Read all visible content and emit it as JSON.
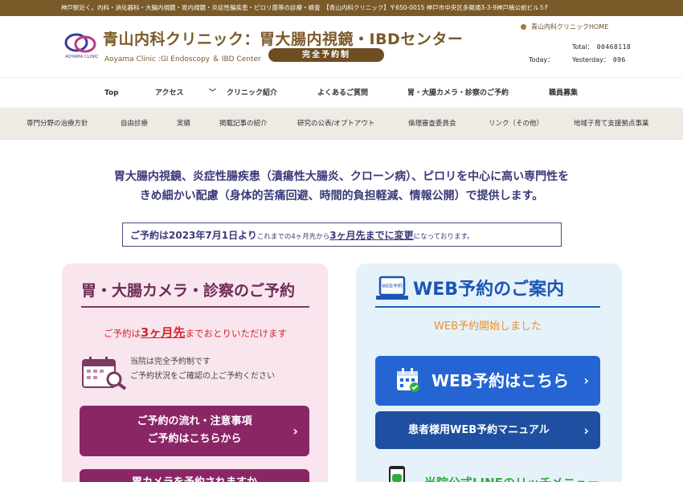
{
  "topbar": {
    "text": "神戸駅近く。内科・消化器科・大腸内視鏡・胃内視鏡・炎症性腸疾患・ピロリ菌等の診療・検査　【青山内科クリニック】〒650-0015 神戸市中央区多聞通3-3-9神戸楠公前ビル５F"
  },
  "header": {
    "logo_caption": "AOYAMA CLINIC",
    "title": "青山内科クリニック：胃大腸内視鏡・IBDセンター",
    "subtitle": "Aoyama Clinic :GI Endoscopy ＆ IBD Center",
    "pill": "完全予約制",
    "home_link": "青山内科クリニックHOME",
    "counter": {
      "total_label": "Total：",
      "total_value": "00468118",
      "today_label": "Today：",
      "yesterday_label": "Yesterday：",
      "yesterday_value": "096"
    }
  },
  "nav_primary": [
    "Top",
    "アクセス",
    "クリニック紹介",
    "よくあるご質問",
    "胃・大腸カメラ・診察のご予約",
    "職員募集"
  ],
  "nav_secondary": [
    "専門分野の治療方針",
    "自由診療",
    "実績",
    "掲載記事の紹介",
    "研究の公表/オプトアウト",
    "倫理審査委員会",
    "リンク（その他）",
    "地域子育て支援拠点事業"
  ],
  "intro": {
    "line1": "胃大腸内視鏡、炎症性腸疾患（潰瘍性大腸炎、クローン病）、ピロリを中心に高い専門性を",
    "line2": "きめ細かい配慮（身体的苦痛回避、時間的負担軽減、情報公開）で提供します。"
  },
  "notice": {
    "part1": "ご予約は2023年7月1日より",
    "part2": "これまでの4ヶ月先から",
    "part3": "3ヶ月先までに変更",
    "part4": "になっております。"
  },
  "pink_card": {
    "title": "胃・大腸カメラ・診察のご予約",
    "red_before": "ご予約は",
    "red_big": "3ヶ月先",
    "red_after": "までおとりいただけます",
    "info1": "当院は完全予約制です",
    "info2": "ご予約状況をご確認の上ご予約ください",
    "button1_line1": "ご予約の流れ・注意事項",
    "button1_line2": "ご予約はこちらから",
    "button2": "胃カメラを予約されますか"
  },
  "blue_card": {
    "icon_label": "WEB予約",
    "title": "WEB予約のご案内",
    "started": "WEB予約開始しました",
    "button1": "WEB予約はこちら",
    "button2": "患者様用WEB予約マニュアル",
    "line_text": "当院公式LINEのリッチメニュー"
  },
  "colors": {
    "brown": "#7a5a28",
    "plum": "#8a2666",
    "blue": "#2465d3",
    "navy": "#1f4fa0",
    "red": "#d6262c",
    "orange": "#e8912a",
    "green": "#2fae3e"
  }
}
